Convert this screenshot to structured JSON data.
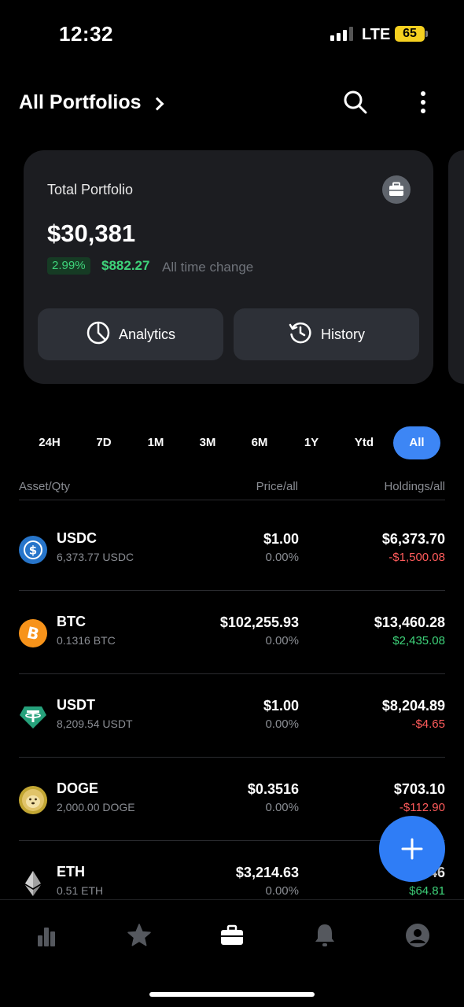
{
  "status_bar": {
    "time": "12:32",
    "network": "LTE",
    "battery": "65"
  },
  "header": {
    "title": "All Portfolios",
    "icons": [
      "chevron-right-icon",
      "search-icon",
      "more-vertical-icon"
    ]
  },
  "portfolio_card": {
    "label": "Total Portfolio",
    "total": "$30,381",
    "change_percent": "2.99%",
    "change_value": "$882.27",
    "change_label": "All time change",
    "analytics_label": "Analytics",
    "history_label": "History"
  },
  "range_tabs": {
    "items": [
      "24H",
      "7D",
      "1M",
      "3M",
      "6M",
      "1Y",
      "Ytd",
      "All"
    ],
    "active": "All"
  },
  "table": {
    "headers": {
      "asset": "Asset/Qty",
      "price": "Price/all",
      "holdings": "Holdings/all"
    },
    "rows": [
      {
        "symbol": "USDC",
        "qty": "6,373.77 USDC",
        "price": "$1.00",
        "price_change": "0.00%",
        "holdings": "$6,373.70",
        "holdings_change": "-$1,500.08",
        "trend": "neg",
        "icon": "usdc-icon",
        "color": "#2775ca"
      },
      {
        "symbol": "BTC",
        "qty": "0.1316 BTC",
        "price": "$102,255.93",
        "price_change": "0.00%",
        "holdings": "$13,460.28",
        "holdings_change": "$2,435.08",
        "trend": "pos",
        "icon": "bitcoin-icon",
        "color": "#f7931a"
      },
      {
        "symbol": "USDT",
        "qty": "8,209.54 USDT",
        "price": "$1.00",
        "price_change": "0.00%",
        "holdings": "$8,204.89",
        "holdings_change": "-$4.65",
        "trend": "neg",
        "icon": "tether-icon",
        "color": "#26a17b"
      },
      {
        "symbol": "DOGE",
        "qty": "2,000.00 DOGE",
        "price": "$0.3516",
        "price_change": "0.00%",
        "holdings": "$703.10",
        "holdings_change": "-$112.90",
        "trend": "neg",
        "icon": "dogecoin-icon",
        "color": "#c2a633"
      },
      {
        "symbol": "ETH",
        "qty": "0.51 ETH",
        "price": "$3,214.63",
        "price_change": "0.00%",
        "holdings": "$1,…46",
        "holdings_change": "$64.81",
        "trend": "pos",
        "icon": "ethereum-icon",
        "color": "#8c8c8c"
      }
    ]
  },
  "bottom_nav": {
    "items": [
      "markets-icon",
      "watchlist-star-icon",
      "portfolio-briefcase-icon",
      "alerts-bell-icon",
      "profile-icon"
    ],
    "active": "portfolio-briefcase-icon"
  },
  "colors": {
    "accent": "#3d86f5",
    "positive": "#3ed37a",
    "negative": "#ff5b5b",
    "card": "#1c1d21"
  }
}
